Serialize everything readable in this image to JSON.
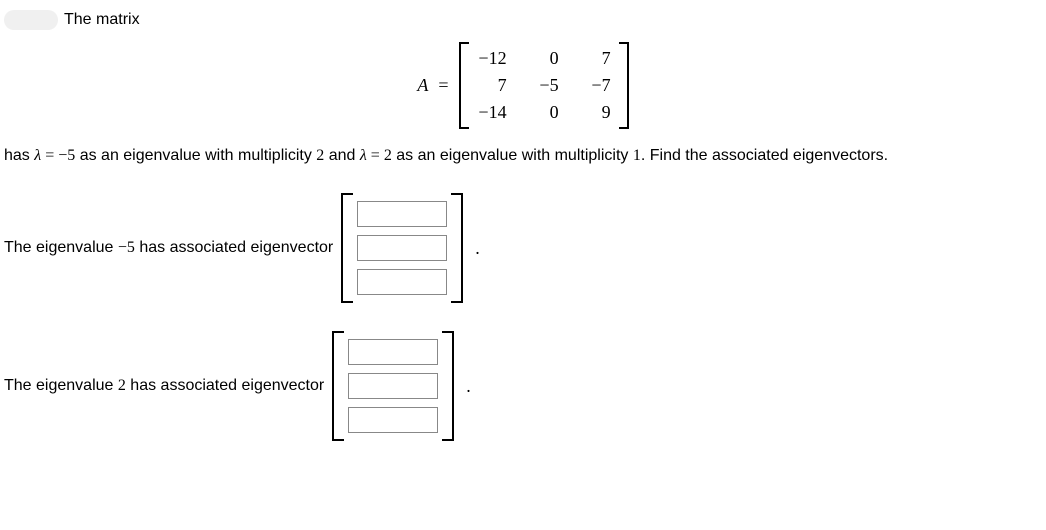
{
  "intro": {
    "text": "The matrix"
  },
  "matrix": {
    "label": "A",
    "eq": "=",
    "cells": [
      [
        "−12",
        "0",
        "7"
      ],
      [
        "7",
        "−5",
        "−7"
      ],
      [
        "−14",
        "0",
        "9"
      ]
    ]
  },
  "sentence": {
    "p1": "has ",
    "lambda1": "λ",
    "eq1": " = ",
    "v1": "−5",
    "p2": " as an eigenvalue with multiplicity ",
    "m1": "2",
    "p3": " and ",
    "lambda2": "λ",
    "eq2": " = ",
    "v2": "2",
    "p4": " as an eigenvalue with multiplicity ",
    "m2": "1",
    "p5": ". Find the associated eigenvectors."
  },
  "answer1": {
    "pre": "The eigenvalue ",
    "val": "−5",
    "post": " has associated eigenvector",
    "inputs": [
      "",
      "",
      ""
    ]
  },
  "answer2": {
    "pre": "The eigenvalue ",
    "val": "2",
    "post": " has associated eigenvector",
    "inputs": [
      "",
      "",
      ""
    ]
  },
  "period": "."
}
